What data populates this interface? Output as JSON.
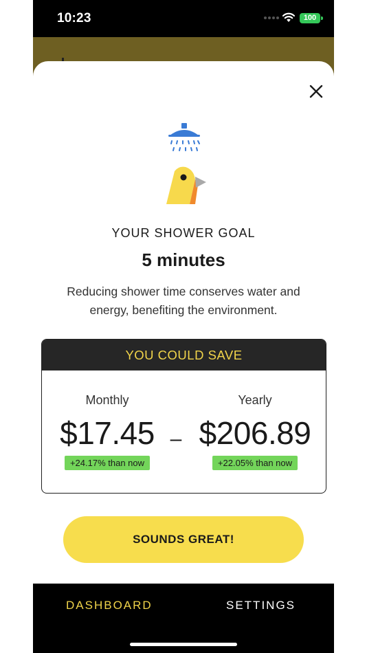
{
  "status_bar": {
    "time": "10:23",
    "battery": "100",
    "wifi_icon": "wifi-icon",
    "battery_color": "#34c759"
  },
  "modal": {
    "close_icon": "close-icon",
    "icons": [
      "shower-icon",
      "bird-icon"
    ],
    "goal_label": "YOUR SHOWER GOAL",
    "goal_value": "5 minutes",
    "description": "Reducing shower time conserves water and energy, benefiting the environment.",
    "savings": {
      "header": "YOU COULD SAVE",
      "monthly_label": "Monthly",
      "monthly_amount": "$17.45",
      "monthly_change": "+24.17% than now",
      "separator": "–",
      "yearly_label": "Yearly",
      "yearly_amount": "$206.89",
      "yearly_change": "+22.05% than now"
    },
    "cta_label": "SOUNDS GREAT!"
  },
  "tab_bar": {
    "dashboard_label": "DASHBOARD",
    "settings_label": "SETTINGS",
    "active_tab": "DASHBOARD"
  },
  "colors": {
    "accent_yellow": "#f7dd4d",
    "header_text_yellow": "#f1d44a",
    "badge_green": "#73d55a",
    "shower_blue": "#3a7bd5",
    "background_header": "#6e5f22"
  }
}
